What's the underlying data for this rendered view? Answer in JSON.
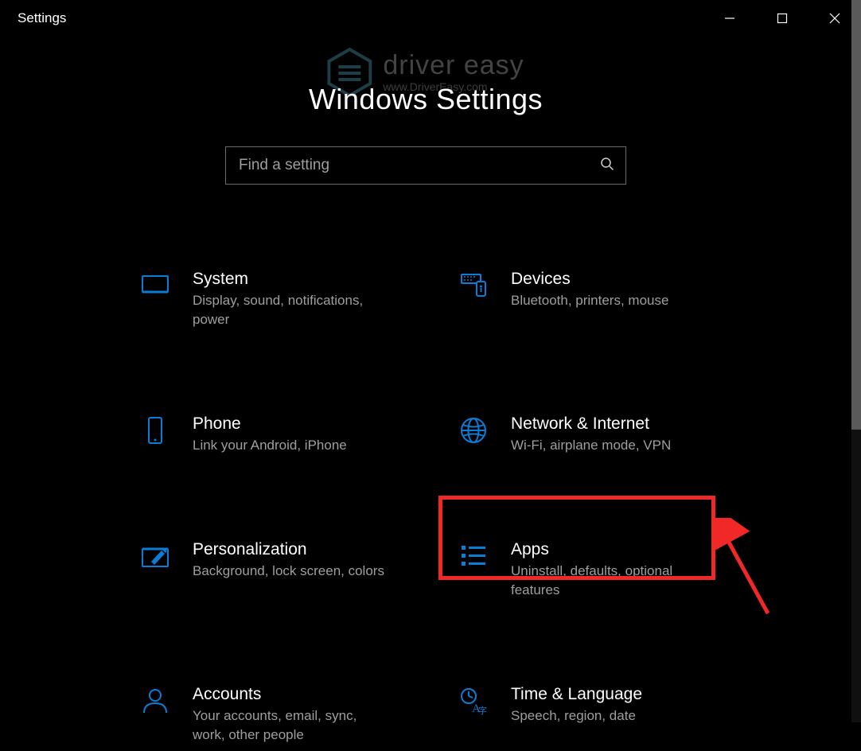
{
  "titlebar": {
    "title": "Settings"
  },
  "watermark": {
    "line1": "driver easy",
    "line2": "www.DriverEasy.com"
  },
  "page": {
    "heading": "Windows Settings"
  },
  "search": {
    "placeholder": "Find a setting"
  },
  "tiles": {
    "system": {
      "label": "System",
      "desc": "Display, sound, notifications, power"
    },
    "devices": {
      "label": "Devices",
      "desc": "Bluetooth, printers, mouse"
    },
    "phone": {
      "label": "Phone",
      "desc": "Link your Android, iPhone"
    },
    "network": {
      "label": "Network & Internet",
      "desc": "Wi-Fi, airplane mode, VPN"
    },
    "personalization": {
      "label": "Personalization",
      "desc": "Background, lock screen, colors"
    },
    "apps": {
      "label": "Apps",
      "desc": "Uninstall, defaults, optional features"
    },
    "accounts": {
      "label": "Accounts",
      "desc": "Your accounts, email, sync, work, other people"
    },
    "time": {
      "label": "Time & Language",
      "desc": "Speech, region, date"
    }
  },
  "colors": {
    "accent": "#0a7dd6",
    "highlight": "#f02828"
  }
}
